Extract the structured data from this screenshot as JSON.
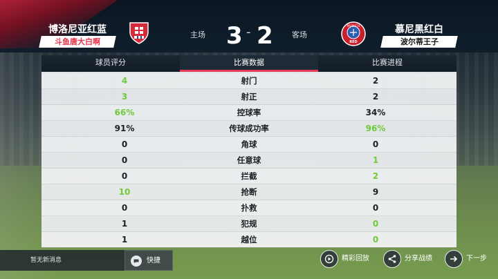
{
  "match": {
    "home": {
      "name": "博洛尼亚红蓝",
      "player": "斗鱼唐大白啊",
      "side_label": "主场",
      "score": "3"
    },
    "away": {
      "name": "慕尼黑红白",
      "player": "波尔蒂王子",
      "side_label": "客场",
      "score": "2",
      "crest_text": "MUNICH",
      "crest_sub": "RED"
    },
    "score_separator": "-"
  },
  "tabs": [
    {
      "label": "球员评分",
      "active": false
    },
    {
      "label": "比赛数据",
      "active": true
    },
    {
      "label": "比赛进程",
      "active": false
    }
  ],
  "stats": [
    {
      "label": "射门",
      "home": "4",
      "away": "2",
      "leader": "home"
    },
    {
      "label": "射正",
      "home": "3",
      "away": "2",
      "leader": "home"
    },
    {
      "label": "控球率",
      "home": "66%",
      "away": "34%",
      "leader": "home"
    },
    {
      "label": "传球成功率",
      "home": "91%",
      "away": "96%",
      "leader": "away"
    },
    {
      "label": "角球",
      "home": "0",
      "away": "0",
      "leader": "none"
    },
    {
      "label": "任意球",
      "home": "0",
      "away": "1",
      "leader": "away"
    },
    {
      "label": "拦截",
      "home": "0",
      "away": "2",
      "leader": "away"
    },
    {
      "label": "抢断",
      "home": "10",
      "away": "9",
      "leader": "home"
    },
    {
      "label": "扑救",
      "home": "0",
      "away": "0",
      "leader": "none"
    },
    {
      "label": "犯规",
      "home": "1",
      "away": "0",
      "leader": "away"
    },
    {
      "label": "越位",
      "home": "1",
      "away": "0",
      "leader": "away"
    }
  ],
  "footer": {
    "message": "暂无新消息",
    "quick_label": "快捷",
    "highlights_label": "精彩回放",
    "share_label": "分享战绩",
    "next_label": "下一步"
  },
  "colors": {
    "accent": "#e63a57",
    "win": "#6fc93a",
    "home_player": "#e8344c"
  }
}
